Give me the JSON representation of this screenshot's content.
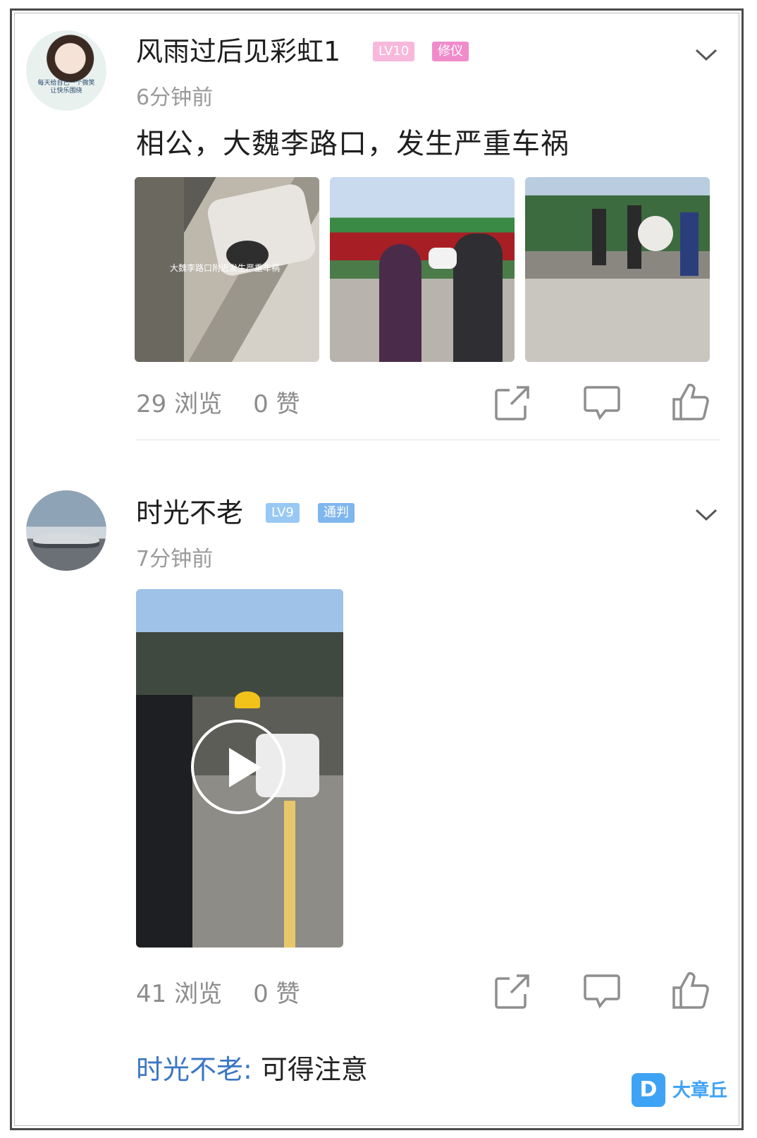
{
  "posts": [
    {
      "username": "风雨过后见彩虹1",
      "level": "LV10",
      "role": "修仪",
      "time": "6分钟前",
      "content": "相公，大魏李路口，发生严重车祸",
      "avatar_caption": "每天给自己一个微笑 让快乐围绕",
      "photo_caption": "大魏李路口附近发生严重车祸",
      "views": "29 浏览",
      "likes": "0 赞",
      "badge_colors": [
        "#f7b8dc",
        "#f08ccb"
      ]
    },
    {
      "username": "时光不老",
      "level": "LV9",
      "role": "通判",
      "time": "7分钟前",
      "views": "41 浏览",
      "likes": "0 赞",
      "badge_colors": [
        "#98c8f4",
        "#7fb6ef"
      ],
      "reply": {
        "author": "时光不老:",
        "text": " 可得注意"
      }
    }
  ],
  "watermark": {
    "logo_letter": "D",
    "text": "大章丘"
  },
  "icons": [
    "chevron-down-icon",
    "share-icon",
    "comment-icon",
    "thumbs-up-icon",
    "play-icon"
  ]
}
